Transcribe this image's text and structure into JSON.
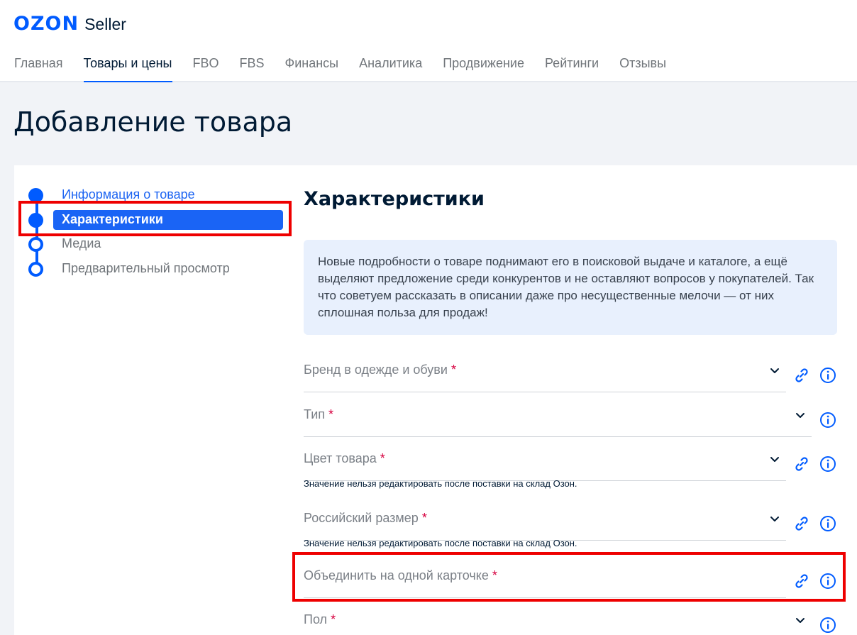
{
  "header": {
    "logo_brand": "OZON",
    "logo_product": "Seller",
    "nav": [
      {
        "label": "Главная"
      },
      {
        "label": "Товары и цены"
      },
      {
        "label": "FBO"
      },
      {
        "label": "FBS"
      },
      {
        "label": "Финансы"
      },
      {
        "label": "Аналитика"
      },
      {
        "label": "Продвижение"
      },
      {
        "label": "Рейтинги"
      },
      {
        "label": "Отзывы"
      }
    ],
    "active_nav": "Товары и цены"
  },
  "page_title": "Добавление товара",
  "steps": [
    {
      "label": "Информация о товаре",
      "state": "done"
    },
    {
      "label": "Характеристики",
      "state": "current"
    },
    {
      "label": "Медиа",
      "state": "pending"
    },
    {
      "label": "Предварительный просмотр",
      "state": "pending"
    }
  ],
  "section_title": "Характеристики",
  "info_text": "Новые подробности о товаре поднимают его в поисковой выдаче и каталоге, а ещё выделяют предложение среди конкурентов и не оставляют вопросов у покупателей. Так что советуем рассказать в описании даже про несущественные мелочи — от них сплошная польза для продаж!",
  "fields": [
    {
      "label": "Бренд в одежде и обуви",
      "required": "*",
      "hint": ""
    },
    {
      "label": "Тип",
      "required": "*",
      "hint": ""
    },
    {
      "label": "Цвет товара",
      "required": "*",
      "hint": "Значение нельзя редактировать после поставки на склад Озон."
    },
    {
      "label": "Российский размер",
      "required": "*",
      "hint": "Значение нельзя редактировать после поставки на склад Озон."
    },
    {
      "label": "Объединить на одной карточке",
      "required": "*",
      "hint": ""
    },
    {
      "label": "Пол",
      "required": "*",
      "hint": ""
    }
  ],
  "colors": {
    "accent": "#005bff",
    "highlight": "#ee0000",
    "required": "#d6003f",
    "info_bg": "#e8f0fd"
  },
  "icons": {
    "dropdown": "chevron-down-icon",
    "link": "link-icon",
    "info": "info-icon"
  }
}
